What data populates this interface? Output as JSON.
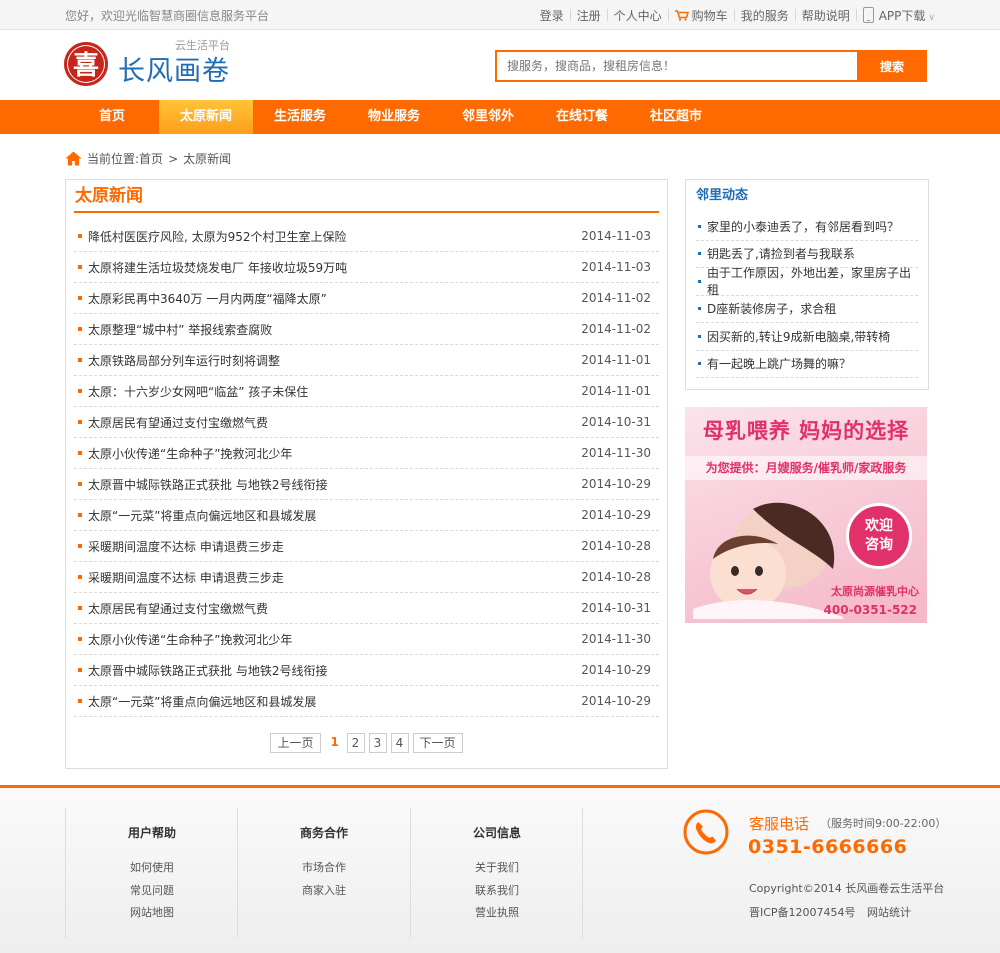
{
  "topbar": {
    "welcome": "您好，欢迎光临智慧商圈信息服务平台",
    "links": [
      "登录",
      "注册",
      "个人中心",
      "购物车",
      "我的服务",
      "帮助说明",
      "APP下载"
    ]
  },
  "header": {
    "logo_seal": "喜",
    "logo_name": "长风画卷",
    "logo_sub": "云生活平台",
    "search_placeholder": "搜服务，搜商品，搜租房信息！",
    "search_button": "搜索"
  },
  "nav": {
    "items": [
      "首页",
      "太原新闻",
      "生活服务",
      "物业服务",
      "邻里邻外",
      "在线订餐",
      "社区超市"
    ],
    "active_index": 1
  },
  "breadcrumb": {
    "label": "当前位置:",
    "home": "首页",
    "sep": ">",
    "current": "太原新闻"
  },
  "news": {
    "title": "太原新闻",
    "items": [
      {
        "title": "降低村医医疗风险, 太原为952个村卫生室上保险",
        "date": "2014-11-03"
      },
      {
        "title": "太原将建生活垃圾焚烧发电厂 年接收垃圾59万吨",
        "date": "2014-11-03"
      },
      {
        "title": "太原彩民再中3640万 一月内两度“福降太原”",
        "date": "2014-11-02"
      },
      {
        "title": "太原整理“城中村” 举报线索查腐败",
        "date": "2014-11-02"
      },
      {
        "title": "太原铁路局部分列车运行时刻将调整",
        "date": "2014-11-01"
      },
      {
        "title": "太原：十六岁少女网吧“临盆” 孩子未保住",
        "date": "2014-11-01"
      },
      {
        "title": "太原居民有望通过支付宝缴燃气费",
        "date": "2014-10-31"
      },
      {
        "title": "太原小伙传递“生命种子”挽救河北少年",
        "date": "2014-11-30"
      },
      {
        "title": "太原晋中城际铁路正式获批 与地铁2号线衔接",
        "date": "2014-10-29"
      },
      {
        "title": "太原“一元菜”将重点向偏远地区和县城发展",
        "date": "2014-10-29"
      },
      {
        "title": "采暖期间温度不达标 申请退费三步走",
        "date": "2014-10-28"
      },
      {
        "title": "采暖期间温度不达标 申请退费三步走",
        "date": "2014-10-28"
      },
      {
        "title": "太原居民有望通过支付宝缴燃气费",
        "date": "2014-10-31"
      },
      {
        "title": "太原小伙传递“生命种子”挽救河北少年",
        "date": "2014-11-30"
      },
      {
        "title": "太原晋中城际铁路正式获批 与地铁2号线衔接",
        "date": "2014-10-29"
      },
      {
        "title": "太原“一元菜”将重点向偏远地区和县城发展",
        "date": "2014-10-29"
      }
    ],
    "pager": {
      "prev": "上一页",
      "pages": [
        "1",
        "2",
        "3",
        "4"
      ],
      "current": "1",
      "next": "下一页"
    }
  },
  "sidebar": {
    "title": "邻里动态",
    "items": [
      "家里的小泰迪丢了，有邻居看到吗？",
      "钥匙丢了,请捡到者与我联系",
      "由于工作原因，外地出差，家里房子出租",
      "D座新装修房子，求合租",
      "因买新的,转让9成新电脑桌,带转椅",
      "有一起晚上跳广场舞的嘛？"
    ],
    "ad": {
      "headline": "母乳喂养 妈妈的选择",
      "subline": "为您提供：月嫂服务/催乳师/家政服务",
      "badge_line1": "欢迎",
      "badge_line2": "咨询",
      "center": "太原尚源催乳中心",
      "tel": "400-0351-522"
    }
  },
  "footer": {
    "columns": [
      {
        "title": "用户帮助",
        "links": [
          "如何使用",
          "常见问题",
          "网站地图"
        ]
      },
      {
        "title": "商务合作",
        "links": [
          "市场合作",
          "商家入驻"
        ]
      },
      {
        "title": "公司信息",
        "links": [
          "关于我们",
          "联系我们",
          "营业执照"
        ]
      }
    ],
    "service_label": "客服电话",
    "service_hours": "（服务时间9:00-22:00）",
    "service_tel": "0351-6666666",
    "copyright": "Copyright©2014 长风画卷云生活平台",
    "icp": "晋ICP备12007454号",
    "stats": "网站统计"
  },
  "colors": {
    "accent": "#ff6a00",
    "brand_blue": "#1f6cb7",
    "seal_red": "#c7251b",
    "ad_pink": "#e0316a"
  }
}
